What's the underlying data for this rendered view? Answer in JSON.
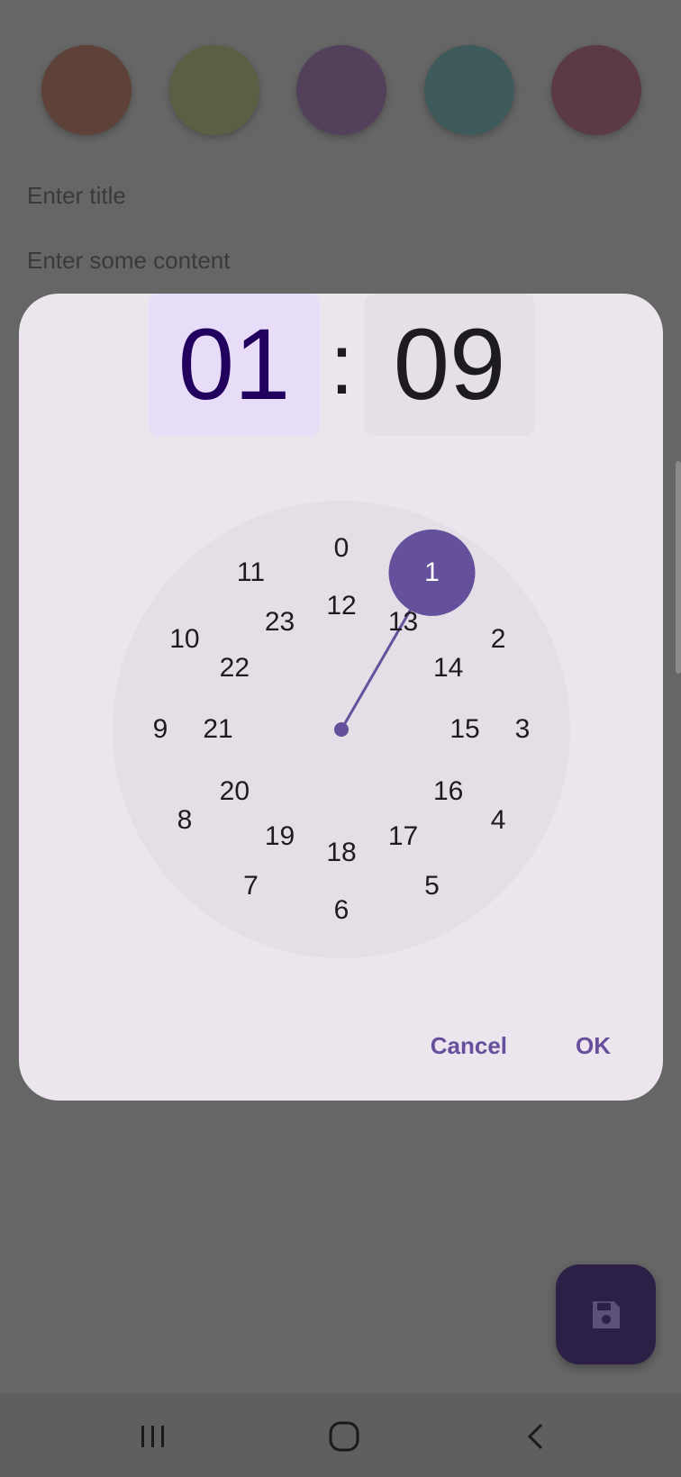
{
  "background": {
    "swatches": [
      {
        "name": "swatch-1",
        "color": "#5E4139"
      },
      {
        "name": "swatch-2",
        "color": "#5B5F43"
      },
      {
        "name": "swatch-3",
        "color": "#53405A"
      },
      {
        "name": "swatch-4",
        "color": "#3F5A5A"
      },
      {
        "name": "swatch-5",
        "color": "#5C3A45"
      }
    ],
    "title_placeholder": "Enter title",
    "content_placeholder": "Enter some content"
  },
  "time_picker": {
    "hour": "01",
    "separator": ":",
    "minute": "09",
    "selected_hour": 1,
    "outer_ring": [
      "0",
      "1",
      "2",
      "3",
      "4",
      "5",
      "6",
      "7",
      "8",
      "9",
      "10",
      "11"
    ],
    "inner_ring": [
      "12",
      "13",
      "14",
      "15",
      "16",
      "17",
      "18",
      "19",
      "20",
      "21",
      "22",
      "23"
    ],
    "cancel_label": "Cancel",
    "ok_label": "OK",
    "colors": {
      "dialog_bg": "#ECE5EE",
      "selected_field_bg": "#E8DDF9",
      "field_bg": "#E5DFE6",
      "clock_face": "#E4DEE6",
      "accent": "#65509C"
    }
  },
  "fab": {
    "icon": "save-icon",
    "color": "#2C2047"
  },
  "navbar": {
    "icons": [
      "recent-apps-icon",
      "home-icon",
      "back-icon"
    ]
  }
}
